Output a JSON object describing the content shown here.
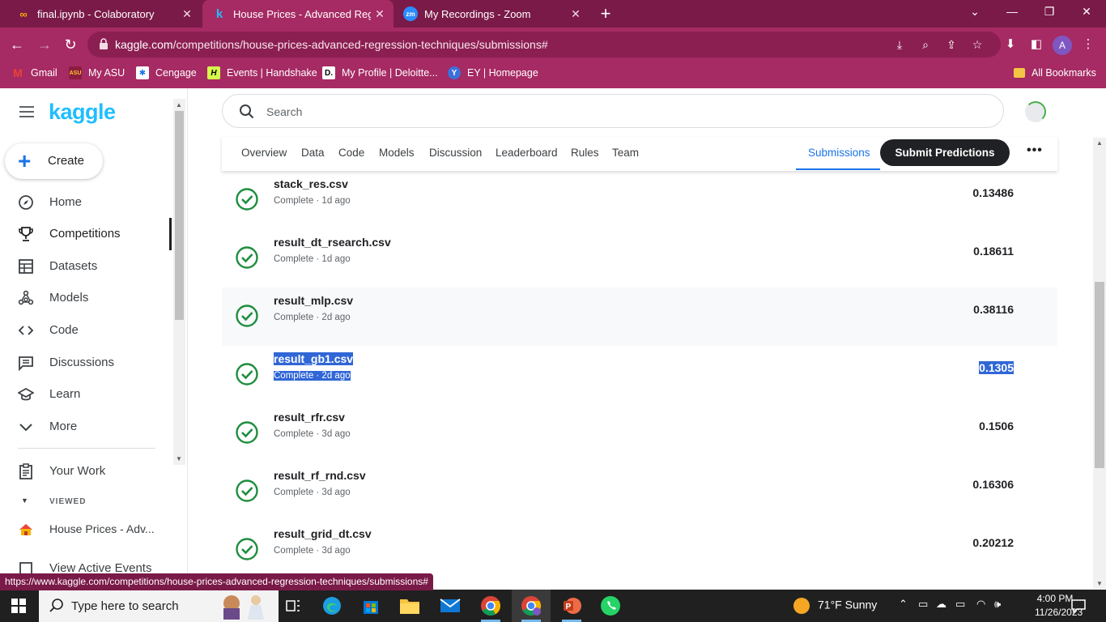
{
  "browser": {
    "tabs": [
      {
        "title": "final.ipynb - Colaboratory",
        "icon": "colab-icon"
      },
      {
        "title": "House Prices - Advanced Regres",
        "icon": "kaggle-icon",
        "active": true
      },
      {
        "title": "My Recordings - Zoom",
        "icon": "zoom-icon"
      }
    ],
    "url_host": "kaggle.com",
    "url_path": "/competitions/house-prices-advanced-regression-techniques/submissions#",
    "avatar_letter": "A",
    "bookmarks": [
      {
        "label": "Gmail"
      },
      {
        "label": "My ASU"
      },
      {
        "label": "Cengage"
      },
      {
        "label": "Events | Handshake"
      },
      {
        "label": "My Profile | Deloitte..."
      },
      {
        "label": "EY | Homepage"
      }
    ],
    "all_bookmarks": "All Bookmarks",
    "status_url": "https://www.kaggle.com/competitions/house-prices-advanced-regression-techniques/submissions#"
  },
  "kaggle": {
    "logo": "kaggle",
    "create_label": "Create",
    "nav": [
      {
        "label": "Home",
        "icon": "compass-icon"
      },
      {
        "label": "Competitions",
        "icon": "trophy-icon",
        "active": true
      },
      {
        "label": "Datasets",
        "icon": "table-icon"
      },
      {
        "label": "Models",
        "icon": "models-icon"
      },
      {
        "label": "Code",
        "icon": "code-icon"
      },
      {
        "label": "Discussions",
        "icon": "discussion-icon"
      },
      {
        "label": "Learn",
        "icon": "graduation-cap-icon"
      },
      {
        "label": "More",
        "icon": "chevron-down-icon"
      }
    ],
    "your_work": "Your Work",
    "viewed_heading": "VIEWED",
    "viewed_item": "House Prices - Adv...",
    "active_events": "View Active Events",
    "search_placeholder": "Search",
    "comp_tabs": [
      "Overview",
      "Data",
      "Code",
      "Models",
      "Discussion",
      "Leaderboard",
      "Rules",
      "Team"
    ],
    "submissions_tab": "Submissions",
    "submit_label": "Submit Predictions",
    "submissions": [
      {
        "file": "stack_res.csv",
        "status": "Complete · 1d ago",
        "score": "0.13486"
      },
      {
        "file": "result_dt_rsearch.csv",
        "status": "Complete · 1d ago",
        "score": "0.18611"
      },
      {
        "file": "result_mlp.csv",
        "status": "Complete · 2d ago",
        "score": "0.38116"
      },
      {
        "file": "result_gb1.csv",
        "status": "Complete · 2d ago",
        "score": "0.1305"
      },
      {
        "file": "result_rfr.csv",
        "status": "Complete · 3d ago",
        "score": "0.1506"
      },
      {
        "file": "result_rf_rnd.csv",
        "status": "Complete · 3d ago",
        "score": "0.16306"
      },
      {
        "file": "result_grid_dt.csv",
        "status": "Complete · 3d ago",
        "score": "0.20212"
      }
    ]
  },
  "taskbar": {
    "search_placeholder": "Type here to search",
    "weather": "71°F  Sunny",
    "time": "4:00 PM",
    "date": "11/26/2023"
  }
}
